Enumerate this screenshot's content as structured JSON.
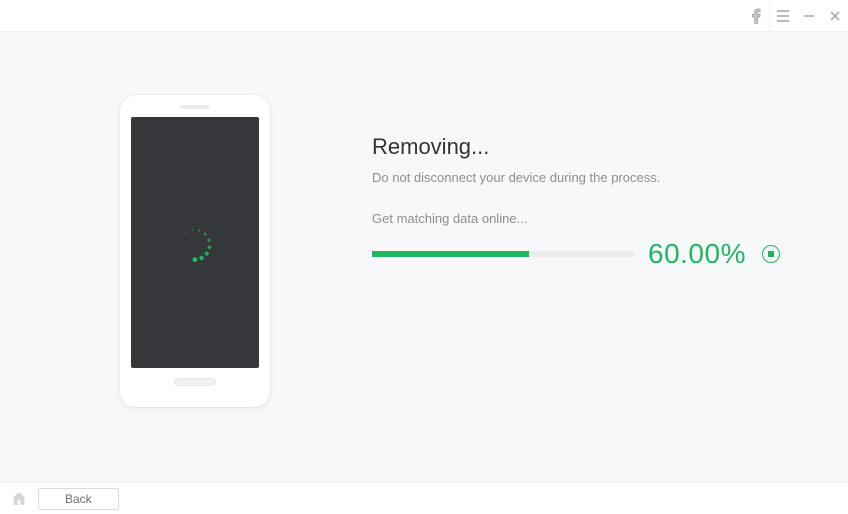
{
  "titlebar": {
    "facebook_icon": "facebook",
    "menu_icon": "menu",
    "minimize_icon": "minimize",
    "close_icon": "close"
  },
  "main": {
    "heading": "Removing...",
    "subtext": "Do not disconnect your device during the process.",
    "status": "Get matching data online...",
    "progress_percent": 60,
    "percent_label": "60.00%"
  },
  "footer": {
    "back_label": "Back"
  },
  "colors": {
    "accent": "#22b560"
  }
}
